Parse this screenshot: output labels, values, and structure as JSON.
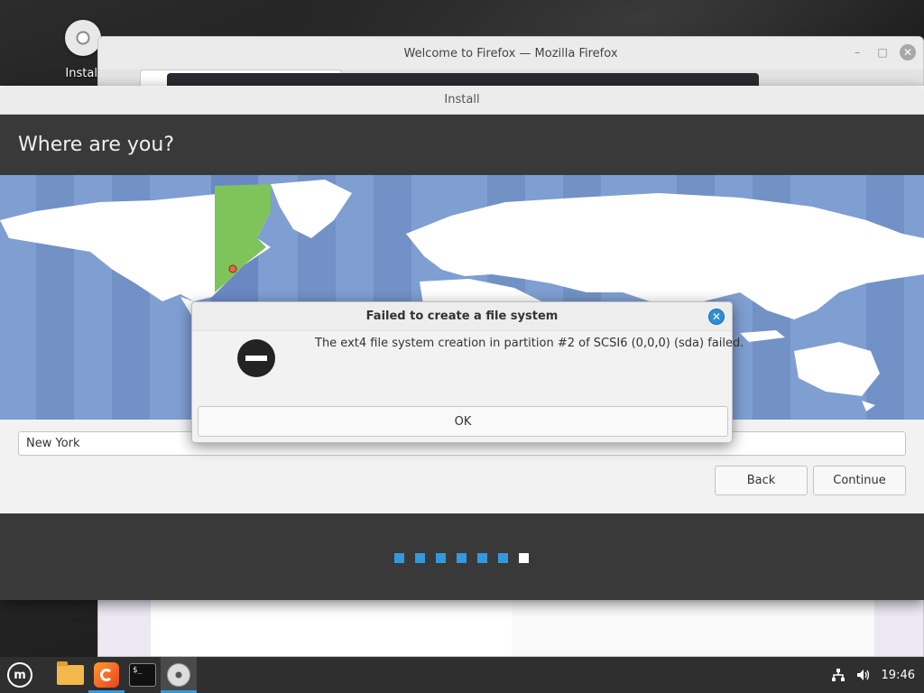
{
  "desktop": {
    "icon_label": "Install"
  },
  "firefox": {
    "title": "Welcome to Firefox — Mozilla Firefox",
    "minimize": "–",
    "maximize": "□",
    "close": "✕"
  },
  "installer": {
    "title": "Install",
    "heading": "Where are you?",
    "city_value": "New York",
    "back_label": "Back",
    "continue_label": "Continue",
    "progress": {
      "total_steps": 7,
      "current_step": 7
    }
  },
  "dialog": {
    "title": "Failed to create a file system",
    "message": "The ext4 file system creation in partition #2 of SCSI6 (0,0,0) (sda) failed.",
    "ok_label": "OK",
    "icon": "error-stop-icon"
  },
  "taskbar": {
    "items": [
      "mint-menu-icon",
      "files-icon",
      "firefox-icon",
      "terminal-icon",
      "install-disc-icon"
    ],
    "terminal_glyph": "$_",
    "menu_glyph": "m",
    "clock": "19:46",
    "tray": [
      "network-icon",
      "volume-icon"
    ]
  },
  "colors": {
    "accent": "#3399dd",
    "header_bg": "#393939",
    "map_ocean": "#7f9ed1",
    "map_land": "#ffffff",
    "timezone_highlight": "#7fc45a"
  }
}
